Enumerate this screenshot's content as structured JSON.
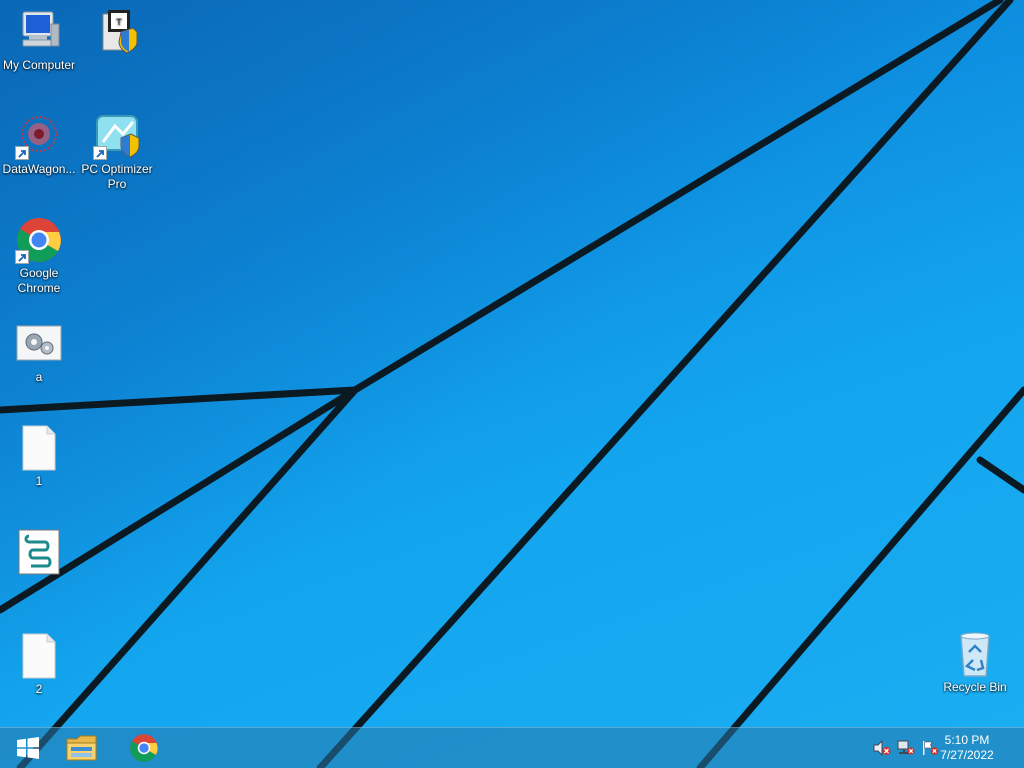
{
  "desktop": {
    "icons": [
      {
        "label": "My Computer",
        "icon": "computer-icon"
      },
      {
        "label": "",
        "icon": "installer-shield-icon"
      },
      {
        "label": "DataWagon...",
        "icon": "datawagon-icon"
      },
      {
        "label": "PC Optimizer Pro",
        "icon": "pc-optimizer-icon"
      },
      {
        "label": "Google Chrome",
        "icon": "chrome-icon"
      },
      {
        "label": "a",
        "icon": "settings-file-icon"
      },
      {
        "label": "1",
        "icon": "blank-file-icon"
      },
      {
        "label": "",
        "icon": "script-file-icon"
      },
      {
        "label": "2",
        "icon": "blank-file-icon"
      },
      {
        "label": "Recycle Bin",
        "icon": "recycle-bin-icon"
      }
    ]
  },
  "taskbar": {
    "pinned": [
      "start-windows-icon",
      "file-explorer-icon",
      "chrome-icon"
    ],
    "tray": [
      "volume-muted-icon",
      "network-error-icon",
      "action-center-flag-icon"
    ],
    "clock": {
      "time": "5:10 PM",
      "date": "7/27/2022"
    }
  },
  "colors": {
    "accent": "#1aa3ee",
    "taskbar": "#2878aa"
  }
}
